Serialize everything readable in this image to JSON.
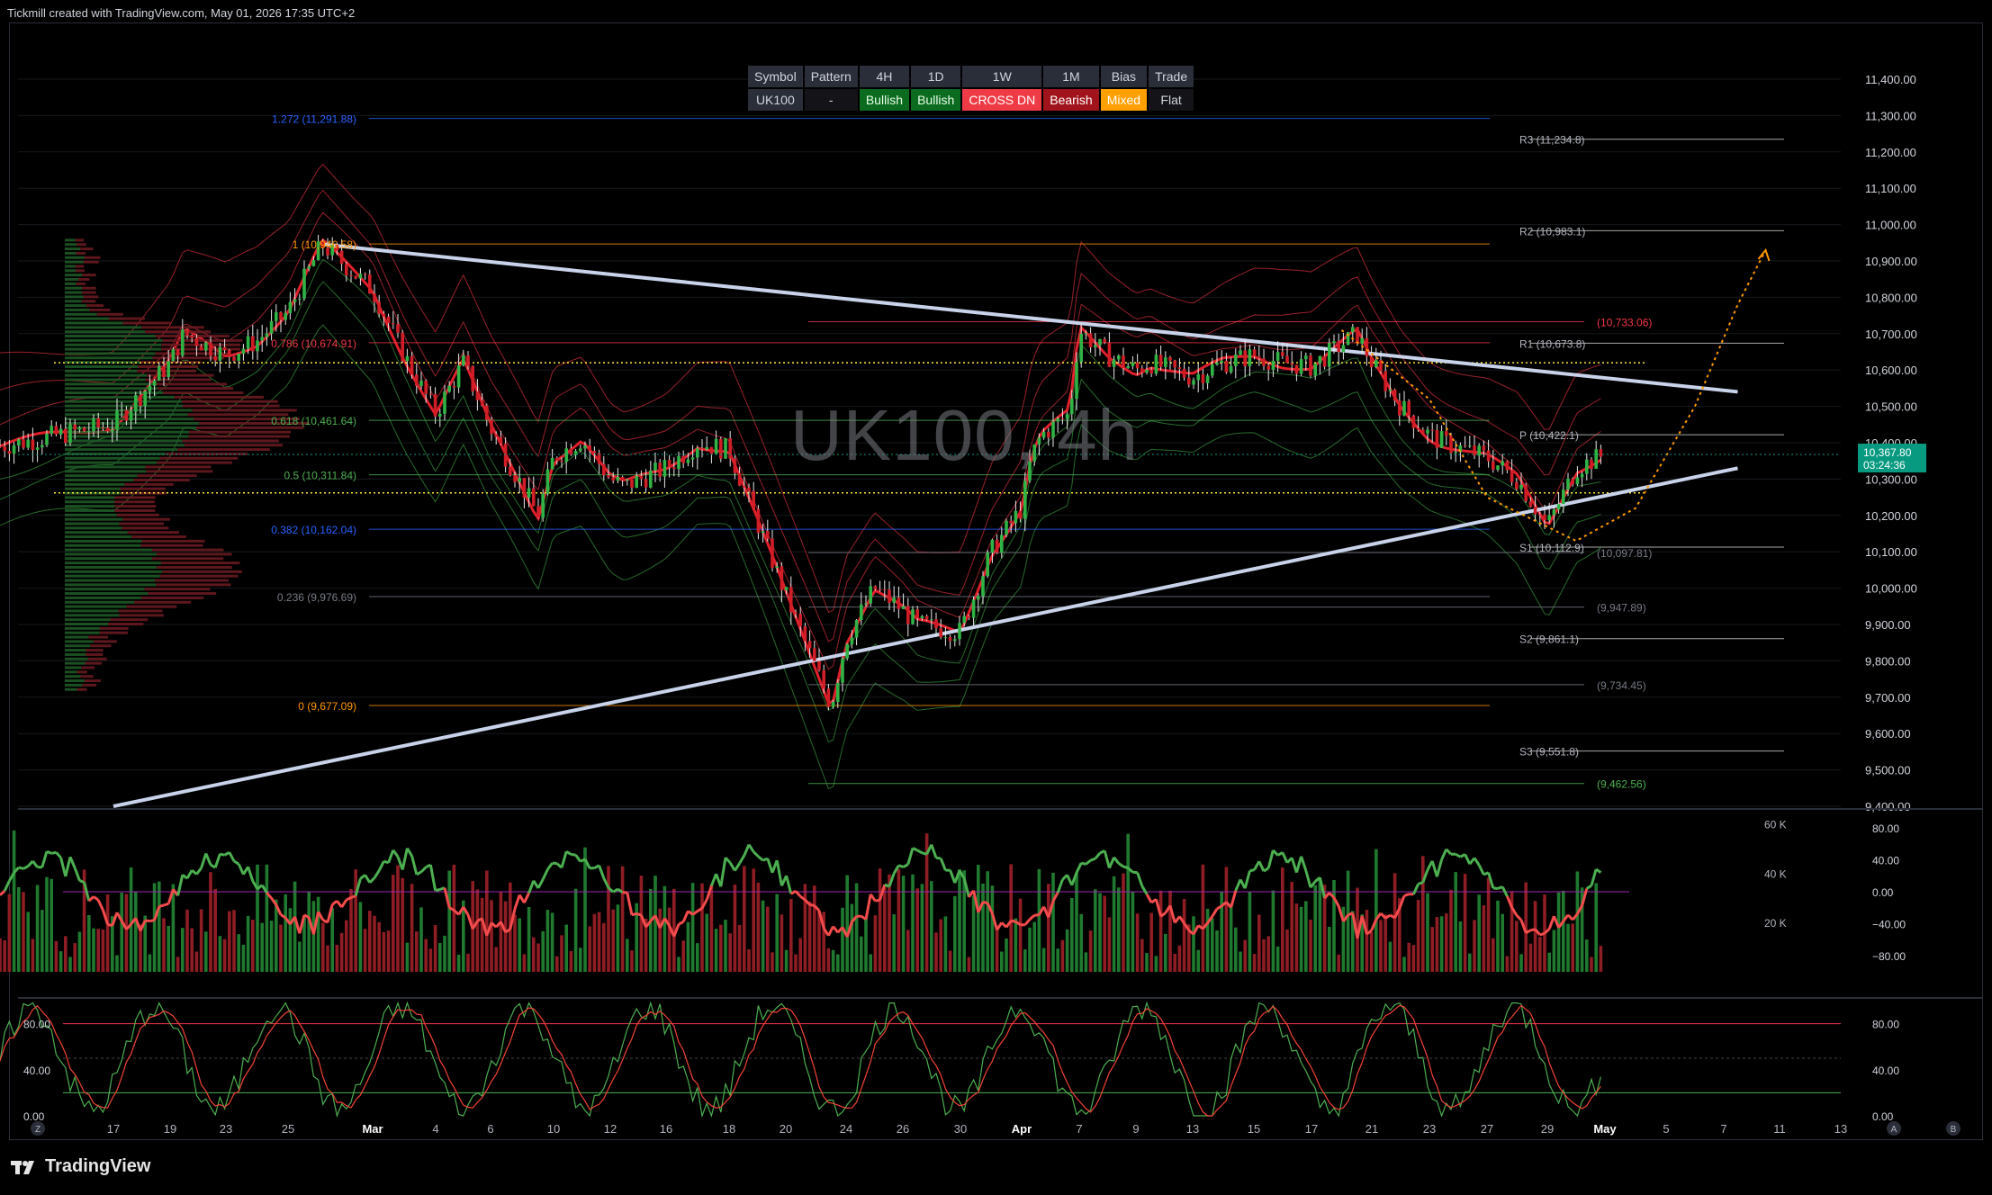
{
  "attribution": "Tickmill created with TradingView.com, May 01, 2026 17:35 UTC+2",
  "watermark": "UK100, 4h",
  "footer_brand": "TradingView",
  "colors": {
    "bull": "#26a69a",
    "bear": "#ef5350",
    "trend_line": "#c8d3ea",
    "price_tag": "#089981",
    "grid": "#16181d"
  },
  "summary_table": {
    "headers": [
      "Symbol",
      "Pattern",
      "4H",
      "1D",
      "1W",
      "1M",
      "Bias",
      "Trade"
    ],
    "values": [
      "UK100",
      "-",
      "Bullish",
      "Bullish",
      "CROSS DN",
      "Bearish",
      "Mixed",
      "Flat"
    ]
  },
  "price_tag": {
    "price": "10,367.80",
    "countdown": "03:24:36"
  },
  "bottom_buttons": [
    "Z",
    "A",
    "B"
  ],
  "chart_data": [
    {
      "type": "candlestick",
      "title": "UK100, 4h",
      "ylim": [
        9400,
        11400
      ],
      "y_ticks": [
        "11,400.00",
        "11,300.00",
        "11,200.00",
        "11,100.00",
        "11,000.00",
        "10,900.00",
        "10,800.00",
        "10,700.00",
        "10,600.00",
        "10,500.00",
        "10,400.00",
        "10,300.00",
        "10,200.00",
        "10,100.00",
        "10,000.00",
        "9,900.00",
        "9,800.00",
        "9,700.00",
        "9,600.00",
        "9,500.00",
        "9,400.00"
      ],
      "x_ticks": [
        "17",
        "19",
        "23",
        "25",
        "Mar",
        "4",
        "6",
        "10",
        "12",
        "16",
        "18",
        "20",
        "24",
        "26",
        "30",
        "Apr",
        "7",
        "9",
        "13",
        "15",
        "17",
        "21",
        "23",
        "27",
        "29",
        "May",
        "5",
        "7",
        "11",
        "13"
      ],
      "close_path": [
        [
          "02-13",
          10390
        ],
        [
          "02-17",
          10450
        ],
        [
          "02-19",
          10620
        ],
        [
          "02-20",
          10700
        ],
        [
          "02-23",
          10640
        ],
        [
          "02-24",
          10680
        ],
        [
          "02-25",
          10760
        ],
        [
          "02-27",
          10946
        ],
        [
          "03-02",
          10820
        ],
        [
          "03-03",
          10640
        ],
        [
          "03-04",
          10480
        ],
        [
          "03-05",
          10620
        ],
        [
          "03-06",
          10440
        ],
        [
          "03-09",
          10200
        ],
        [
          "03-10",
          10360
        ],
        [
          "03-11",
          10410
        ],
        [
          "03-12",
          10300
        ],
        [
          "03-13",
          10280
        ],
        [
          "03-16",
          10330
        ],
        [
          "03-17",
          10400
        ],
        [
          "03-18",
          10380
        ],
        [
          "03-19",
          10180
        ],
        [
          "03-20",
          9980
        ],
        [
          "03-23",
          9677
        ],
        [
          "03-24",
          9860
        ],
        [
          "03-25",
          10000
        ],
        [
          "03-26",
          9940
        ],
        [
          "03-27",
          9900
        ],
        [
          "03-30",
          9880
        ],
        [
          "03-31",
          10100
        ],
        [
          "04-01",
          10220
        ],
        [
          "04-02",
          10360
        ],
        [
          "04-03",
          10420
        ],
        [
          "04-06",
          10480
        ],
        [
          "04-07",
          10710
        ],
        [
          "04-08",
          10640
        ],
        [
          "04-09",
          10600
        ],
        [
          "04-10",
          10620
        ],
        [
          "04-13",
          10580
        ],
        [
          "04-14",
          10620
        ],
        [
          "04-15",
          10640
        ],
        [
          "04-16",
          10620
        ],
        [
          "04-17",
          10610
        ],
        [
          "04-20",
          10700
        ],
        [
          "04-21",
          10620
        ],
        [
          "04-22",
          10500
        ],
        [
          "04-23",
          10420
        ],
        [
          "04-24",
          10400
        ],
        [
          "04-27",
          10360
        ],
        [
          "04-28",
          10300
        ],
        [
          "04-29",
          10170
        ],
        [
          "04-30",
          10330
        ],
        [
          "05-01",
          10367.8
        ]
      ],
      "fibonacci": [
        {
          "label": "1.272 (11,291.88)",
          "value": 11291.88,
          "color": "#2962ff"
        },
        {
          "label": "1 (10,946.58)",
          "value": 10946.58,
          "color": "#ff9800"
        },
        {
          "label": "0.786 (10,674.91)",
          "value": 10674.91,
          "color": "#f23645"
        },
        {
          "label": "0.618 (10,461.64)",
          "value": 10461.64,
          "color": "#4caf50"
        },
        {
          "label": "0.5 (10,311.84)",
          "value": 10311.84,
          "color": "#4caf50"
        },
        {
          "label": "0.382 (10,162.04)",
          "value": 10162.04,
          "color": "#2962ff"
        },
        {
          "label": "0.236 (9,976.69)",
          "value": 9976.69,
          "color": "#787b86"
        },
        {
          "label": "0 (9,677.09)",
          "value": 9677.09,
          "color": "#ff9800"
        }
      ],
      "pivots": [
        {
          "label": "R3 (11,234.8)",
          "value": 11234.8
        },
        {
          "label": "R2 (10,983.1)",
          "value": 10983.1
        },
        {
          "label": "R1 (10,673.8)",
          "value": 10673.8
        },
        {
          "label": "P (10,422.1)",
          "value": 10422.1
        },
        {
          "label": "S1 (10,112.9)",
          "value": 10112.9
        },
        {
          "label": "S2 (9,861.1)",
          "value": 9861.1
        },
        {
          "label": "S3 (9,551.8)",
          "value": 9551.8
        }
      ],
      "levels": [
        {
          "label": "(10,733.06)",
          "value": 10733.06,
          "color": "#f23645"
        },
        {
          "label": "(10,097.81)",
          "value": 10097.81,
          "color": "#787b86"
        },
        {
          "label": "(9,947.89)",
          "value": 9947.89,
          "color": "#787b86"
        },
        {
          "label": "(9,734.45)",
          "value": 9734.45,
          "color": "#787b86"
        },
        {
          "label": "(9,462.56)",
          "value": 9462.56,
          "color": "#4caf50"
        }
      ],
      "dotted_levels": [
        10620,
        10262
      ],
      "trend_lines": [
        {
          "from": [
            "02-27",
            10946
          ],
          "to": [
            "05-08",
            10540
          ]
        },
        {
          "from": [
            "02-17",
            9400
          ],
          "to": [
            "05-08",
            10330
          ]
        }
      ],
      "projection": [
        [
          "04-19",
          10710
        ],
        [
          "04-23",
          10520
        ],
        [
          "04-27",
          10250
        ],
        [
          "04-30",
          10130
        ],
        [
          "05-03",
          10220
        ],
        [
          "05-06",
          10500
        ],
        [
          "05-08",
          10780
        ],
        [
          "05-10",
          10930
        ]
      ]
    },
    {
      "type": "bar+line",
      "title": "",
      "volume_ticks": [
        "60 K",
        "40 K",
        "20 K"
      ],
      "oscillator_ticks": [
        "80.00",
        "40.00",
        "0.00",
        "−40.00",
        "−80.00"
      ],
      "oscillator_range": [
        -100,
        100
      ],
      "volume_range": [
        0,
        65000
      ]
    },
    {
      "type": "line",
      "title": "",
      "y_ticks": [
        "80.00",
        "40.00",
        "0.00"
      ],
      "ylim": [
        0,
        100
      ],
      "overbought": 80,
      "oversold": 20
    }
  ]
}
